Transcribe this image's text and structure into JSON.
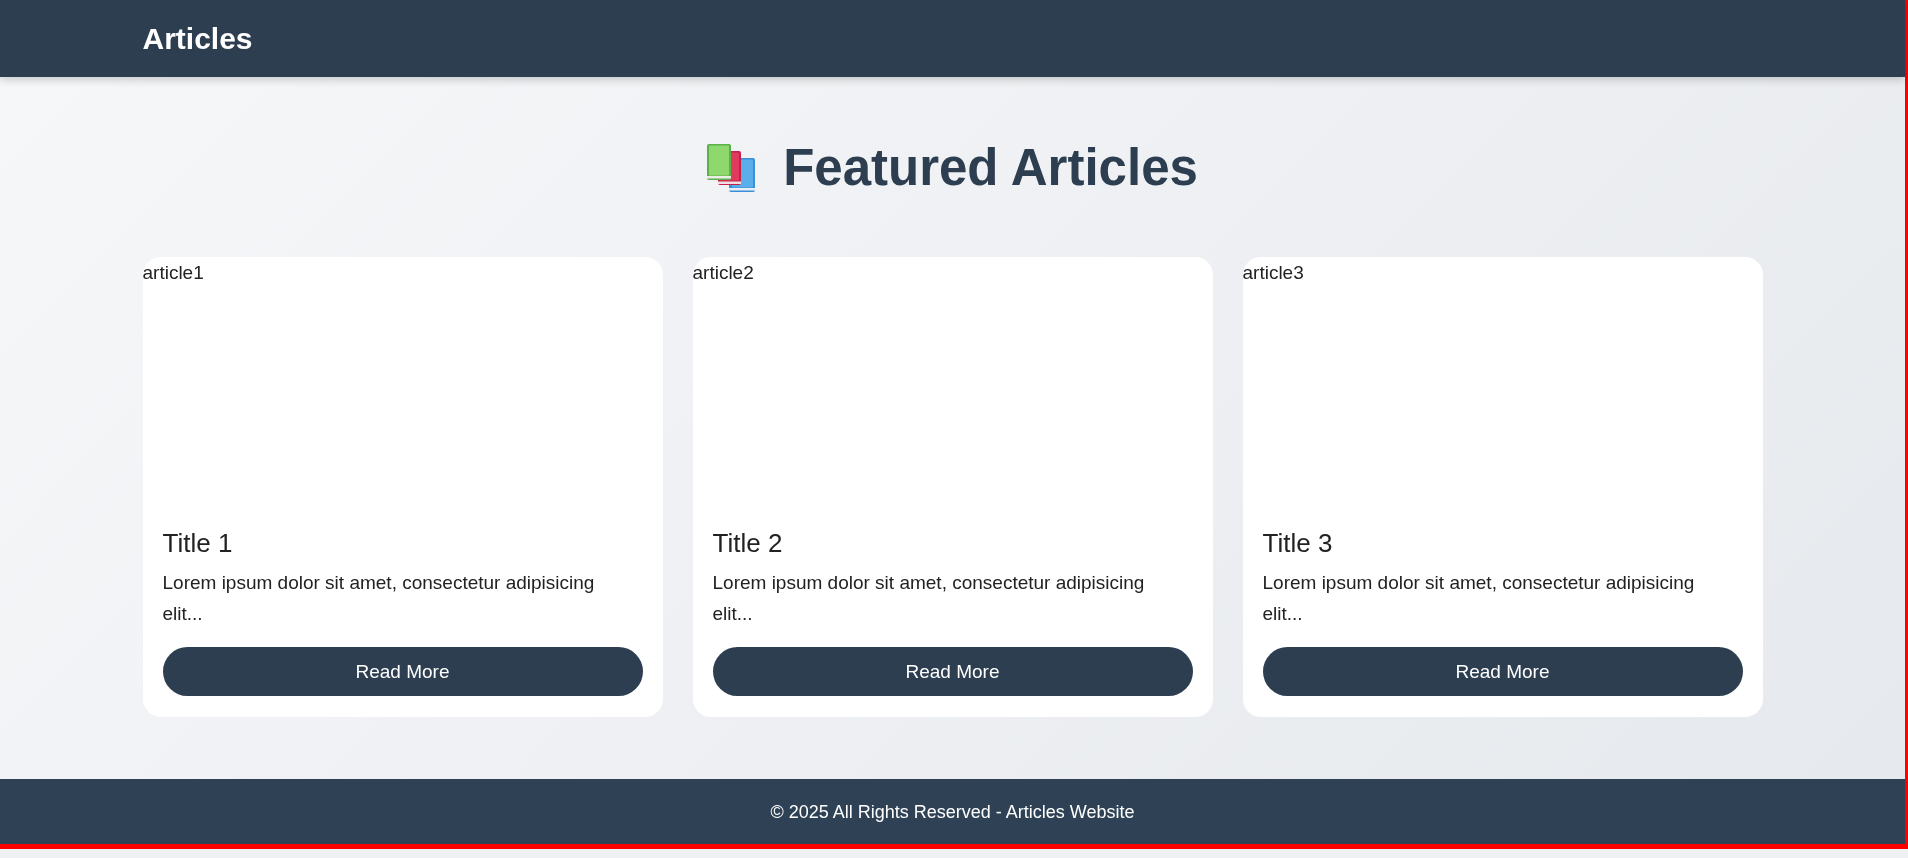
{
  "header": {
    "title": "Articles"
  },
  "hero": {
    "heading": "Featured Articles"
  },
  "articles": [
    {
      "image_alt": "article1",
      "title": "Title 1",
      "excerpt": "Lorem ipsum dolor sit amet, consectetur adipisicing elit...",
      "button": "Read More"
    },
    {
      "image_alt": "article2",
      "title": "Title 2",
      "excerpt": "Lorem ipsum dolor sit amet, consectetur adipisicing elit...",
      "button": "Read More"
    },
    {
      "image_alt": "article3",
      "title": "Title 3",
      "excerpt": "Lorem ipsum dolor sit amet, consectetur adipisicing elit...",
      "button": "Read More"
    }
  ],
  "footer": {
    "text": "© 2025 All Rights Reserved - Articles Website"
  }
}
